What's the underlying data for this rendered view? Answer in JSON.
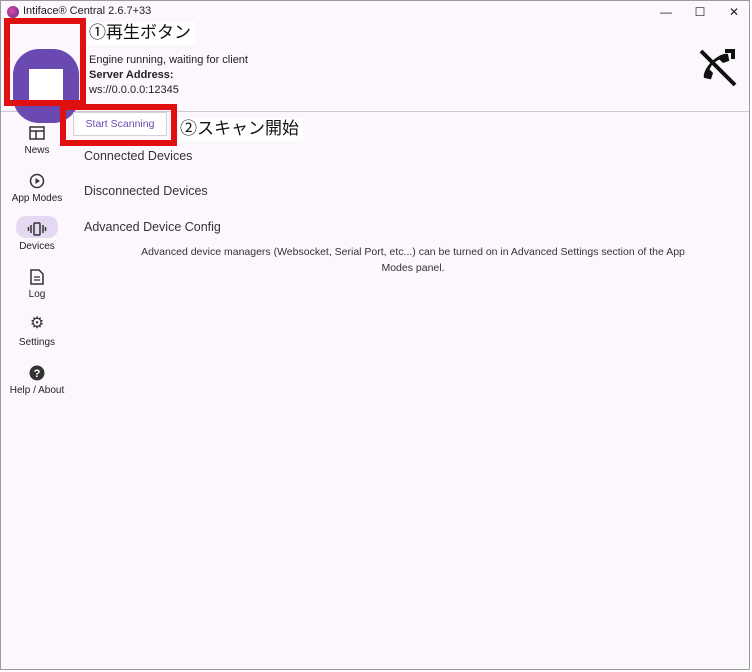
{
  "window": {
    "title": "Intiface® Central 2.6.7+33",
    "minimize_glyph": "—",
    "maximize_glyph": "☐",
    "close_glyph": "✕"
  },
  "header": {
    "engine_status": "Engine running, waiting for client",
    "server_address_label": "Server Address:",
    "server_address": "ws://0.0.0.0:12345",
    "stop_icon": "stop-icon",
    "client_icon": "phone-disabled-icon"
  },
  "annotations": {
    "play_button": "①再生ボタン",
    "start_scan": "②スキャン開始",
    "highlight_color": "#e01010"
  },
  "sidebar": {
    "items": [
      {
        "label": "News",
        "icon": "news-icon"
      },
      {
        "label": "App Modes",
        "icon": "play-circle-icon"
      },
      {
        "label": "Devices",
        "icon": "vibration-icon"
      },
      {
        "label": "Log",
        "icon": "document-icon"
      },
      {
        "label": "Settings",
        "icon": "gear-icon"
      },
      {
        "label": "Help / About",
        "icon": "help-icon"
      }
    ],
    "active": "Devices"
  },
  "main": {
    "scan_button": "Start Scanning",
    "sections": [
      "Connected Devices",
      "Disconnected Devices",
      "Advanced Device Config"
    ],
    "advanced_note": "Advanced device managers (Websocket, Serial Port, etc...) can be turned on in Advanced Settings section of the App Modes panel."
  },
  "colors": {
    "accent": "#6a4ab0",
    "background": "#fcf7fc",
    "active_nav": "#e4d8f3"
  }
}
